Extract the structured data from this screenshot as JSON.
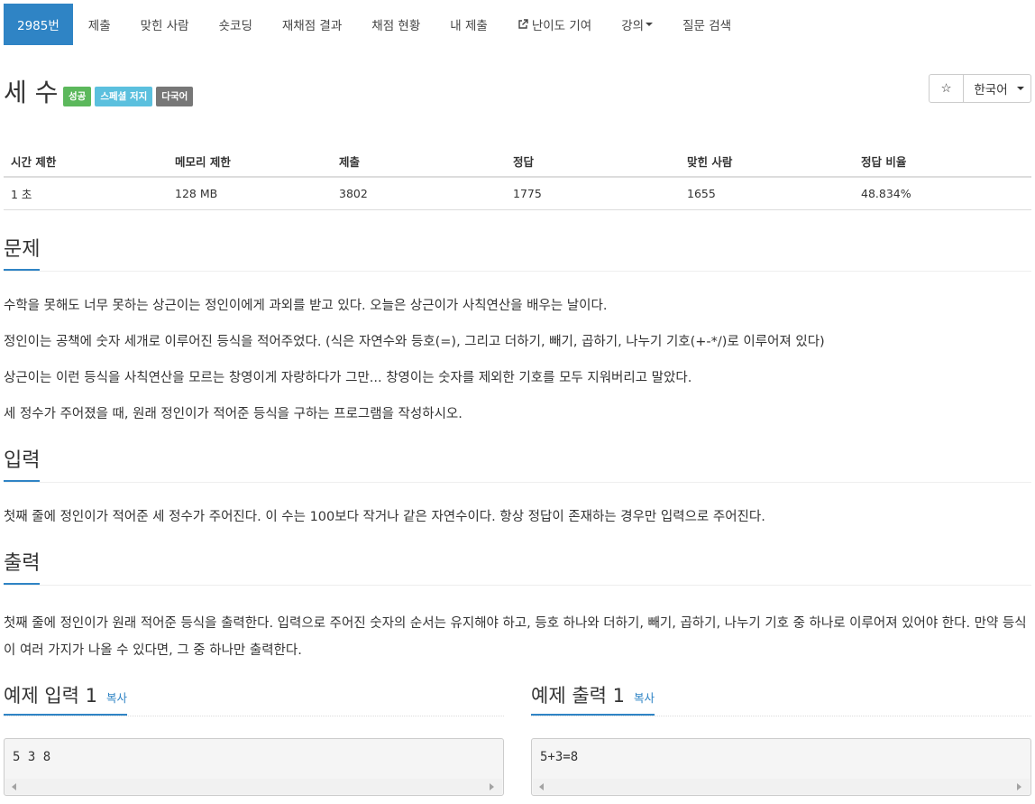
{
  "nav": [
    {
      "label": "2985번",
      "active": true
    },
    {
      "label": "제출"
    },
    {
      "label": "맞힌 사람"
    },
    {
      "label": "숏코딩"
    },
    {
      "label": "재채점 결과"
    },
    {
      "label": "채점 현황"
    },
    {
      "label": "내 제출"
    },
    {
      "label": "난이도 기여",
      "icon": "external-link-icon"
    },
    {
      "label": "강의",
      "dropdown": true
    },
    {
      "label": "질문 검색"
    }
  ],
  "problem": {
    "title": "세 수",
    "badges": [
      "성공",
      "스페셜 저지",
      "다국어"
    ],
    "star": "☆",
    "language": "한국어"
  },
  "info_table": {
    "headers": [
      "시간 제한",
      "메모리 제한",
      "제출",
      "정답",
      "맞힌 사람",
      "정답 비율"
    ],
    "values": [
      "1 초",
      "128 MB",
      "3802",
      "1775",
      "1655",
      "48.834%"
    ]
  },
  "sections": {
    "problem": {
      "heading": "문제",
      "paragraphs": [
        "수학을 못해도 너무 못하는 상근이는 정인이에게 과외를 받고 있다. 오늘은 상근이가 사칙연산을 배우는 날이다.",
        "정인이는 공책에 숫자 세개로 이루어진 등식을 적어주었다. (식은 자연수와 등호(=), 그리고 더하기, 빼기, 곱하기, 나누기 기호(+-*/)로 이루어져 있다)",
        "상근이는 이런 등식을 사칙연산을 모르는 창영이게 자랑하다가 그만... 창영이는 숫자를 제외한 기호를 모두 지워버리고 말았다.",
        "세 정수가 주어졌을 때, 원래 정인이가 적어준 등식을 구하는 프로그램을 작성하시오."
      ]
    },
    "input": {
      "heading": "입력",
      "text": "첫째 줄에 정인이가 적어준 세 정수가 주어진다. 이 수는 100보다 작거나 같은 자연수이다. 항상 정답이 존재하는 경우만 입력으로 주어진다."
    },
    "output": {
      "heading": "출력",
      "text": "첫째 줄에 정인이가 원래 적어준 등식을 출력한다. 입력으로 주어진 숫자의 순서는 유지해야 하고, 등호 하나와 더하기, 빼기, 곱하기, 나누기 기호 중 하나로 이루어져 있어야 한다. 만약 등식이 여러 가지가 나올 수 있다면, 그 중 하나만 출력한다."
    }
  },
  "samples": {
    "input": {
      "heading": "예제 입력 1",
      "copy": "복사",
      "content": "5 3 8"
    },
    "output": {
      "heading": "예제 출력 1",
      "copy": "복사",
      "content": "5+3=8"
    }
  }
}
